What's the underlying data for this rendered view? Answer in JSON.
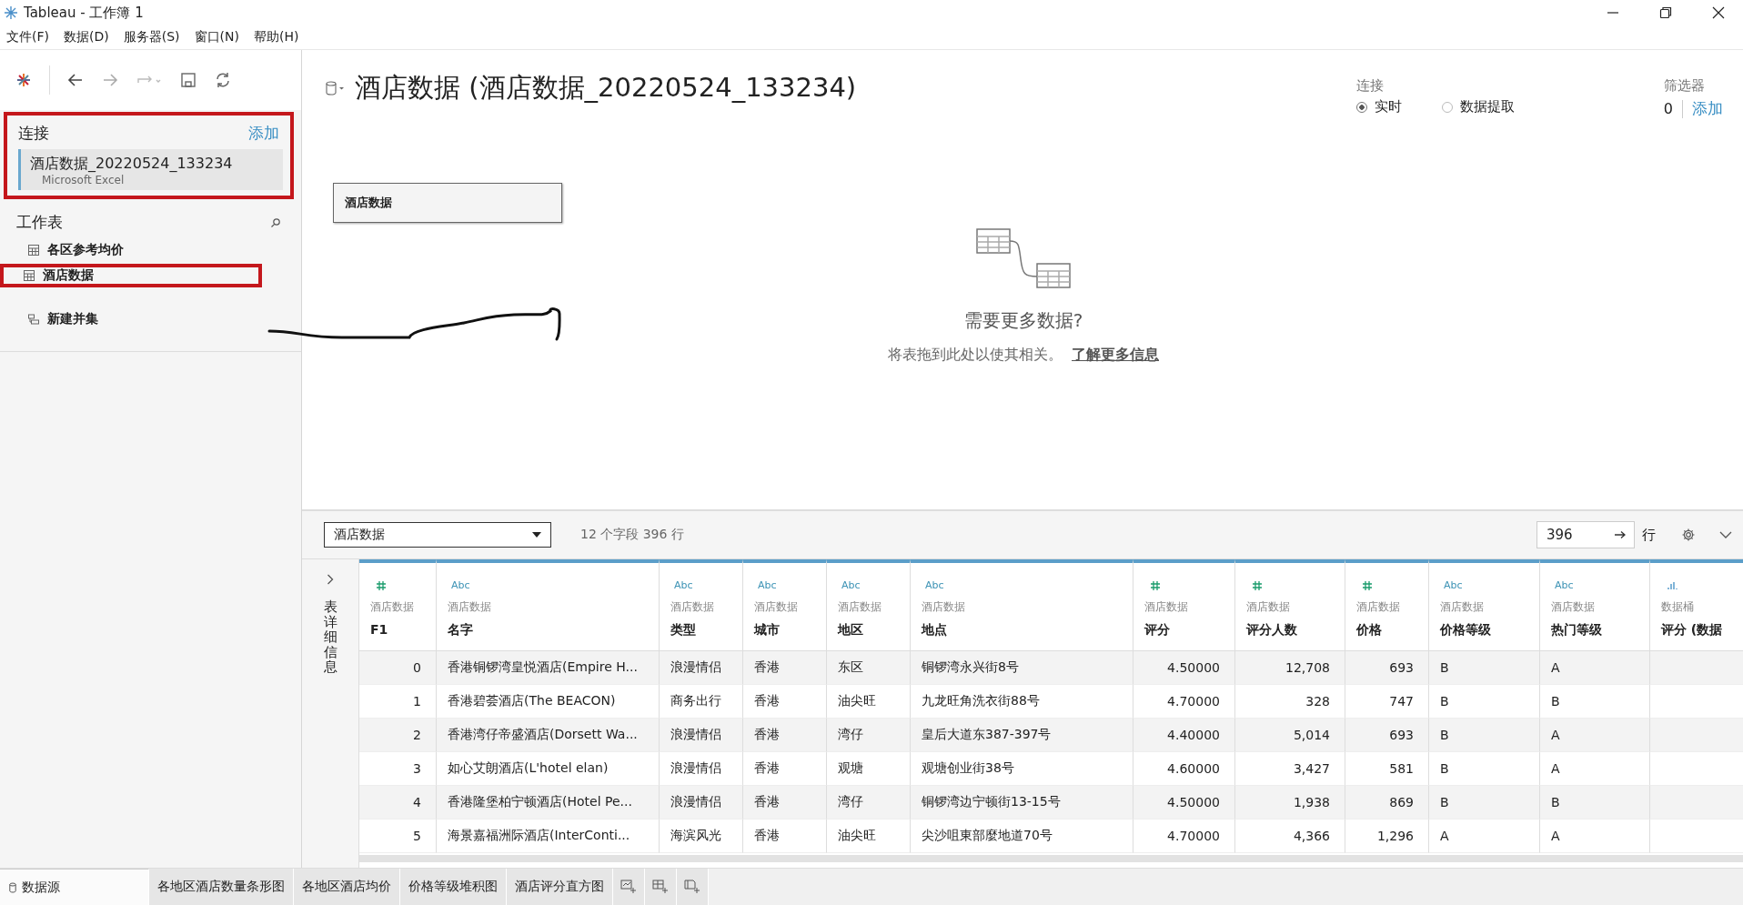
{
  "window": {
    "title": "Tableau - 工作簿 1"
  },
  "menu": [
    "文件(F)",
    "数据(D)",
    "服务器(S)",
    "窗口(N)",
    "帮助(H)"
  ],
  "connections": {
    "heading": "连接",
    "add": "添加",
    "highlighted": true,
    "items": [
      {
        "name": "酒店数据_20220524_133234",
        "type": "Microsoft Excel"
      }
    ]
  },
  "sheets": {
    "heading": "工作表",
    "items": [
      {
        "label": "各区参考均价",
        "highlighted": false
      },
      {
        "label": "酒店数据",
        "highlighted": true
      }
    ],
    "new_union": "新建并集"
  },
  "datasource": {
    "title": "酒店数据 (酒店数据_20220524_133234)",
    "connection_label": "连接",
    "options": [
      {
        "label": "实时",
        "selected": true
      },
      {
        "label": "数据提取",
        "selected": false
      }
    ],
    "filters_label": "筛选器",
    "filters_count": "0",
    "filters_add": "添加"
  },
  "canvas": {
    "tables": [
      "酒店数据"
    ],
    "hint_title": "需要更多数据?",
    "hint_text": "将表拖到此处以使其相关。",
    "hint_link": "了解更多信息"
  },
  "grid_toolbar": {
    "table": "酒店数据",
    "summary": "12 个字段 396 行",
    "rows_value": "396",
    "rows_label": "行"
  },
  "details_label": "表详细信息",
  "table": {
    "columns": [
      {
        "kind": "number",
        "source": "酒店数据",
        "name": "F1"
      },
      {
        "kind": "string",
        "type_label": "Abc",
        "source": "酒店数据",
        "name": "名字"
      },
      {
        "kind": "string",
        "type_label": "Abc",
        "source": "酒店数据",
        "name": "类型"
      },
      {
        "kind": "string",
        "type_label": "Abc",
        "source": "酒店数据",
        "name": "城市"
      },
      {
        "kind": "string",
        "type_label": "Abc",
        "source": "酒店数据",
        "name": "地区"
      },
      {
        "kind": "string",
        "type_label": "Abc",
        "source": "酒店数据",
        "name": "地点"
      },
      {
        "kind": "number",
        "source": "酒店数据",
        "name": "评分"
      },
      {
        "kind": "number",
        "source": "酒店数据",
        "name": "评分人数"
      },
      {
        "kind": "number",
        "source": "酒店数据",
        "name": "价格"
      },
      {
        "kind": "string",
        "type_label": "Abc",
        "source": "酒店数据",
        "name": "价格等级"
      },
      {
        "kind": "string",
        "type_label": "Abc",
        "source": "酒店数据",
        "name": "热门等级"
      },
      {
        "kind": "bin",
        "source": "数据桶",
        "name": "评分 (数据"
      }
    ],
    "rows": [
      [
        "0",
        "香港铜锣湾皇悦酒店(Empire H...",
        "浪漫情侣",
        "香港",
        "东区",
        "铜锣湾永兴街8号",
        "4.50000",
        "12,708",
        "693",
        "B",
        "A"
      ],
      [
        "1",
        "香港碧荟酒店(The BEACON)",
        "商务出行",
        "香港",
        "油尖旺",
        "九龙旺角洗衣街88号",
        "4.70000",
        "328",
        "747",
        "B",
        "B"
      ],
      [
        "2",
        "香港湾仔帝盛酒店(Dorsett Wa...",
        "浪漫情侣",
        "香港",
        "湾仔",
        "皇后大道东387-397号",
        "4.40000",
        "5,014",
        "693",
        "B",
        "A"
      ],
      [
        "3",
        "如心艾朗酒店(L'hotel elan)",
        "浪漫情侣",
        "香港",
        "观塘",
        "观塘创业街38号",
        "4.60000",
        "3,427",
        "581",
        "B",
        "A"
      ],
      [
        "4",
        "香港隆堡柏宁顿酒店(Hotel Pe...",
        "浪漫情侣",
        "香港",
        "湾仔",
        "铜锣湾边宁顿街13-15号",
        "4.50000",
        "1,938",
        "869",
        "B",
        "B"
      ],
      [
        "5",
        "海景嘉福洲际酒店(InterConti...",
        "海滨风光",
        "香港",
        "油尖旺",
        "尖沙咀東部麼地道70号",
        "4.70000",
        "4,366",
        "1,296",
        "A",
        "A"
      ]
    ]
  },
  "sheet_tabs": [
    {
      "label": "数据源",
      "kind": "datasource",
      "selected": true
    },
    {
      "label": "各地区酒店数量条形图",
      "kind": "sheet",
      "selected": false
    },
    {
      "label": "各地区酒店均价",
      "kind": "sheet",
      "selected": false
    },
    {
      "label": "价格等级堆积图",
      "kind": "sheet",
      "selected": false
    },
    {
      "label": "酒店评分直方图",
      "kind": "sheet",
      "selected": false
    }
  ]
}
